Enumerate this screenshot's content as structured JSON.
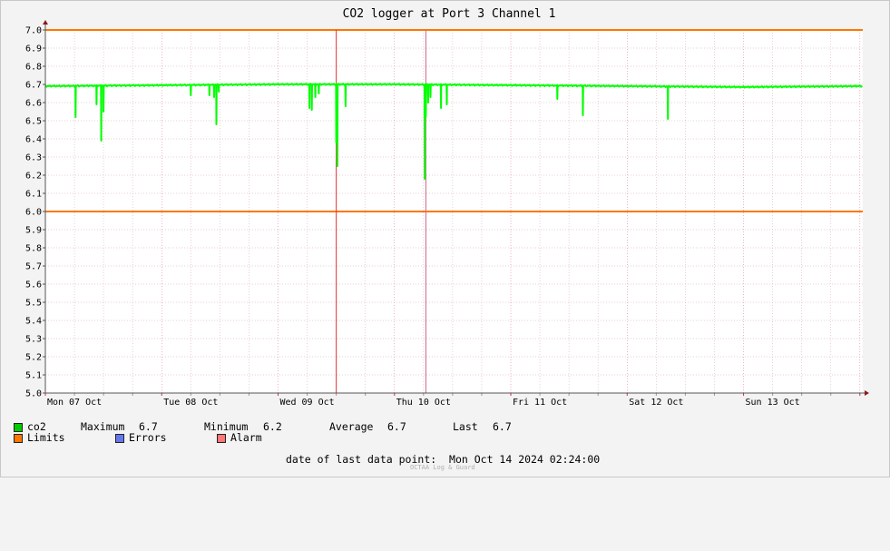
{
  "chart_data": {
    "type": "line",
    "title": "CO2 logger at Port 3 Channel 1",
    "xlabel": "",
    "ylabel": "",
    "ylim": [
      5.0,
      7.0
    ],
    "yticks": [
      "7.0",
      "6.9",
      "6.8",
      "6.7",
      "6.6",
      "6.5",
      "6.4",
      "6.3",
      "6.2",
      "6.1",
      "6.0",
      "5.9",
      "5.8",
      "5.7",
      "5.6",
      "5.5",
      "5.4",
      "5.3",
      "5.2",
      "5.1",
      "5.0"
    ],
    "x_range_days": [
      0,
      7.025
    ],
    "x_ticks": [
      {
        "label": "Mon 07 Oct",
        "pos": 0.25
      },
      {
        "label": "Tue 08 Oct",
        "pos": 1.25
      },
      {
        "label": "Wed 09 Oct",
        "pos": 2.25
      },
      {
        "label": "Thu 10 Oct",
        "pos": 3.25
      },
      {
        "label": "Fri 11 Oct",
        "pos": 4.25
      },
      {
        "label": "Sat 12 Oct",
        "pos": 5.25
      },
      {
        "label": "Sun 13 Oct",
        "pos": 6.25
      }
    ],
    "grid": true,
    "limits": [
      7.0,
      6.0
    ],
    "vertical_markers": [
      2.5,
      3.27
    ],
    "series": [
      {
        "name": "co2",
        "color": "#00ff00",
        "baseline": [
          [
            0,
            6.69
          ],
          [
            1.0,
            6.695
          ],
          [
            2.0,
            6.7
          ],
          [
            3.0,
            6.7
          ],
          [
            4.0,
            6.695
          ],
          [
            5.0,
            6.69
          ],
          [
            6.0,
            6.685
          ],
          [
            7.0,
            6.69
          ]
        ],
        "dips": [
          [
            0.26,
            6.52
          ],
          [
            0.44,
            6.59
          ],
          [
            0.48,
            6.39
          ],
          [
            0.5,
            6.55
          ],
          [
            1.25,
            6.64
          ],
          [
            1.41,
            6.64
          ],
          [
            1.45,
            6.63
          ],
          [
            1.47,
            6.48
          ],
          [
            1.49,
            6.66
          ],
          [
            2.27,
            6.57
          ],
          [
            2.29,
            6.56
          ],
          [
            2.32,
            6.63
          ],
          [
            2.35,
            6.65
          ],
          [
            2.5,
            6.38
          ],
          [
            2.51,
            6.25
          ],
          [
            2.58,
            6.58
          ],
          [
            3.26,
            6.18
          ],
          [
            3.27,
            6.52
          ],
          [
            3.29,
            6.6
          ],
          [
            3.31,
            6.63
          ],
          [
            3.4,
            6.57
          ],
          [
            3.45,
            6.59
          ],
          [
            4.4,
            6.62
          ],
          [
            4.62,
            6.53
          ],
          [
            5.35,
            6.51
          ]
        ]
      }
    ]
  },
  "legend": {
    "co2": {
      "label": "co2",
      "color": "#00cc00"
    },
    "stats": {
      "max_label": "Maximum",
      "max": "6.7",
      "min_label": "Minimum",
      "min": "6.2",
      "avg_label": "Average",
      "avg": "6.7",
      "last_label": "Last",
      "last": "6.7"
    },
    "limits": {
      "label": "Limits",
      "color": "#ff7700"
    },
    "errors": {
      "label": "Errors",
      "color": "#6677ee"
    },
    "alarm": {
      "label": "Alarm",
      "color": "#ff7777"
    }
  },
  "footer": {
    "date_label": "date of last data point:",
    "date_value": "Mon Oct 14 2024 02:24:00",
    "watermark": "OCTAA Log & Guard"
  }
}
